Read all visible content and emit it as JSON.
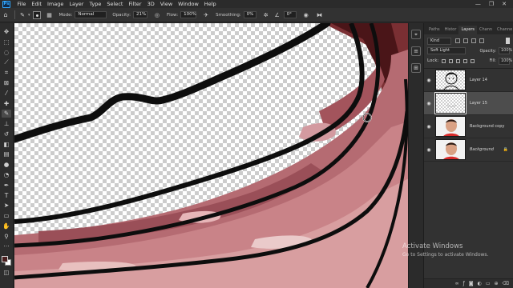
{
  "app": {
    "logo_text": "Ps"
  },
  "menu": {
    "items": [
      "File",
      "Edit",
      "Image",
      "Layer",
      "Type",
      "Select",
      "Filter",
      "3D",
      "View",
      "Window",
      "Help"
    ]
  },
  "window_controls": {
    "minimize": "—",
    "maximize": "❐",
    "close": "✕"
  },
  "options": {
    "mode_label": "Mode:",
    "mode_value": "Normal",
    "opacity_label": "Opacity:",
    "opacity_value": "21%",
    "flow_label": "Flow:",
    "flow_value": "100%",
    "smoothing_label": "Smoothing:",
    "smoothing_value": "0%",
    "angle_value": "0°"
  },
  "tools": [
    "move-tool",
    "marquee-tool",
    "lasso-tool",
    "quick-select-tool",
    "crop-tool",
    "frame-tool",
    "eyedropper-tool",
    "healing-brush-tool",
    "brush-tool",
    "clone-stamp-tool",
    "history-brush-tool",
    "eraser-tool",
    "gradient-tool",
    "blur-tool",
    "dodge-tool",
    "pen-tool",
    "type-tool",
    "path-select-tool",
    "shape-tool",
    "hand-tool",
    "zoom-tool"
  ],
  "colors": {
    "foreground": "#4a1f1f",
    "background": "#ffffff",
    "accent": "#31a8ff"
  },
  "panel": {
    "tabs": [
      "Paths",
      "Histor",
      "Layers",
      "Chann",
      "Channe"
    ],
    "active_tab": "Layers",
    "filter_value": "Kind",
    "blend_mode": "Soft Light",
    "opacity_label": "Opacity:",
    "opacity_value": "100%",
    "lock_label": "Lock:",
    "fill_label": "Fill:",
    "fill_value": "100%"
  },
  "layers": [
    {
      "name": "Layer 14",
      "visible": true,
      "selected": false,
      "italic": false
    },
    {
      "name": "Layer 15",
      "visible": true,
      "selected": true,
      "italic": false
    },
    {
      "name": "Background copy",
      "visible": true,
      "selected": false,
      "italic": false
    },
    {
      "name": "Background",
      "visible": true,
      "selected": false,
      "italic": true
    }
  ],
  "watermark": {
    "title": "Activate Windows",
    "subtitle": "Go to Settings to activate Windows."
  }
}
